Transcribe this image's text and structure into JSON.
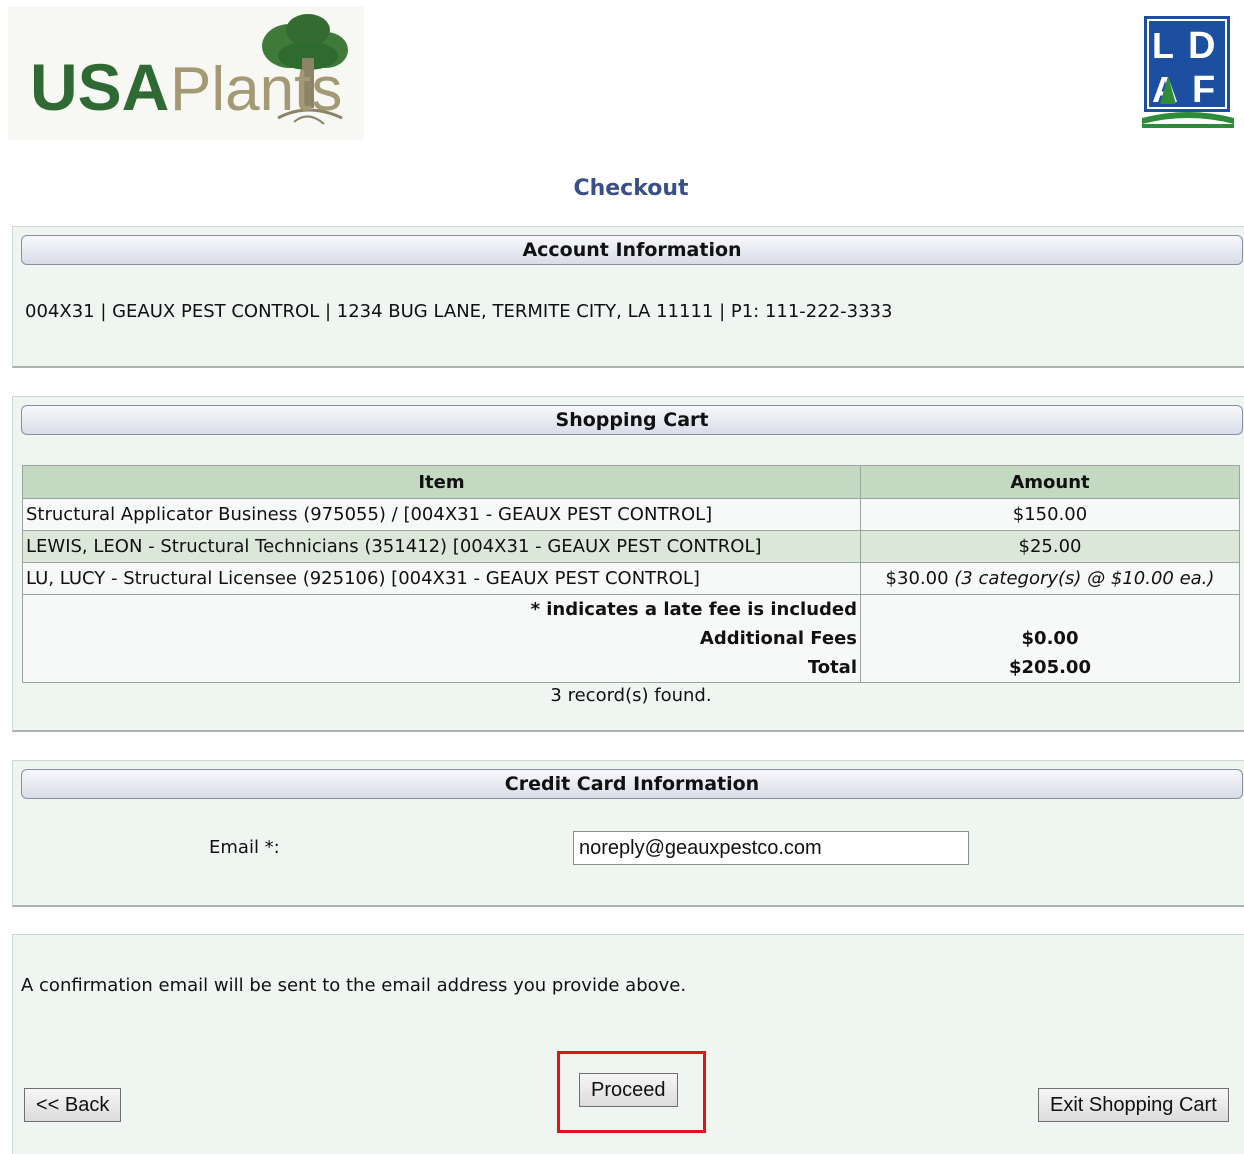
{
  "logos": {
    "left_text_usa": "USA",
    "left_text_plants": "Plants",
    "right_text_l": "L",
    "right_text_d": "D",
    "right_text_a": "A",
    "right_text_f": "F"
  },
  "page": {
    "title": "Checkout"
  },
  "account": {
    "heading": "Account Information",
    "details": "004X31 | GEAUX PEST CONTROL | 1234 BUG LANE, TERMITE CITY, LA 11111 | P1: 111-222-3333"
  },
  "cart": {
    "heading": "Shopping Cart",
    "columns": {
      "item": "Item",
      "amount": "Amount"
    },
    "rows": [
      {
        "item": "Structural Applicator Business (975055) / [004X31 - GEAUX PEST CONTROL]",
        "amount": "$150.00",
        "detail": ""
      },
      {
        "item": "LEWIS, LEON - Structural Technicians (351412) [004X31 - GEAUX PEST CONTROL]",
        "amount": "$25.00",
        "detail": ""
      },
      {
        "item": "LU, LUCY - Structural Licensee (925106) [004X31 - GEAUX PEST CONTROL]",
        "amount": "$30.00",
        "detail": "(3 category(s) @ $10.00 ea.)"
      }
    ],
    "late_fee_note": "* indicates a late fee is included",
    "additional_fees_label": "Additional Fees",
    "additional_fees_value": "$0.00",
    "total_label": "Total",
    "total_value": "$205.00",
    "records_found": "3 record(s) found."
  },
  "credit_card": {
    "heading": "Credit Card Information",
    "email_label": "Email *:",
    "email_value": "noreply@geauxpestco.com"
  },
  "footer": {
    "confirmation_text": "A confirmation email will be sent to the email address you provide above.",
    "back_label": "<< Back",
    "proceed_label": "Proceed",
    "exit_label": "Exit Shopping Cart"
  },
  "colors": {
    "panel_bg": "#eff5f1",
    "table_header_bg": "#c4d9c2",
    "title_color": "#3a4f86",
    "highlight": "#e01414"
  }
}
